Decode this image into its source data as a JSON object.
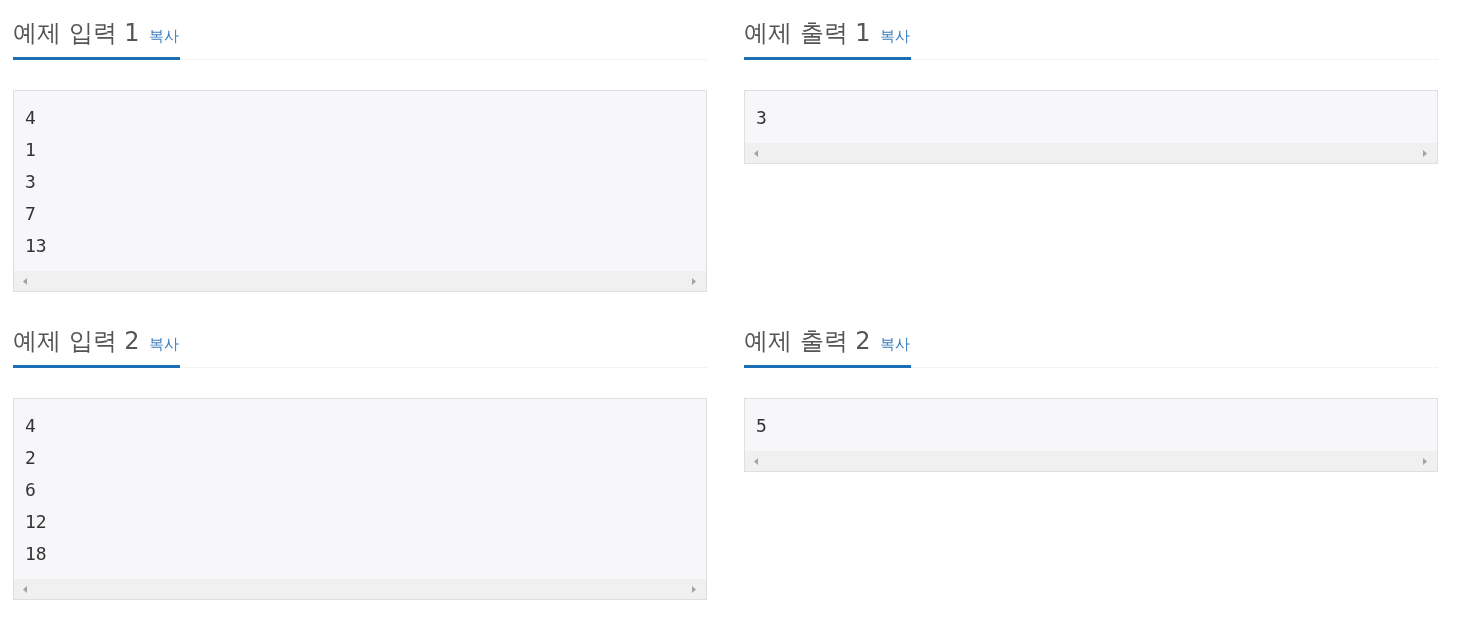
{
  "samples": [
    {
      "title": "예제 입력 1",
      "copy_link": "복사",
      "text": "4\n1\n3\n7\n13"
    },
    {
      "title": "예제 출력 1",
      "copy_link": "복사",
      "text": "3"
    },
    {
      "title": "예제 입력 2",
      "copy_link": "복사",
      "text": "4\n2\n6\n12\n18"
    },
    {
      "title": "예제 출력 2",
      "copy_link": "복사",
      "text": "5"
    }
  ]
}
